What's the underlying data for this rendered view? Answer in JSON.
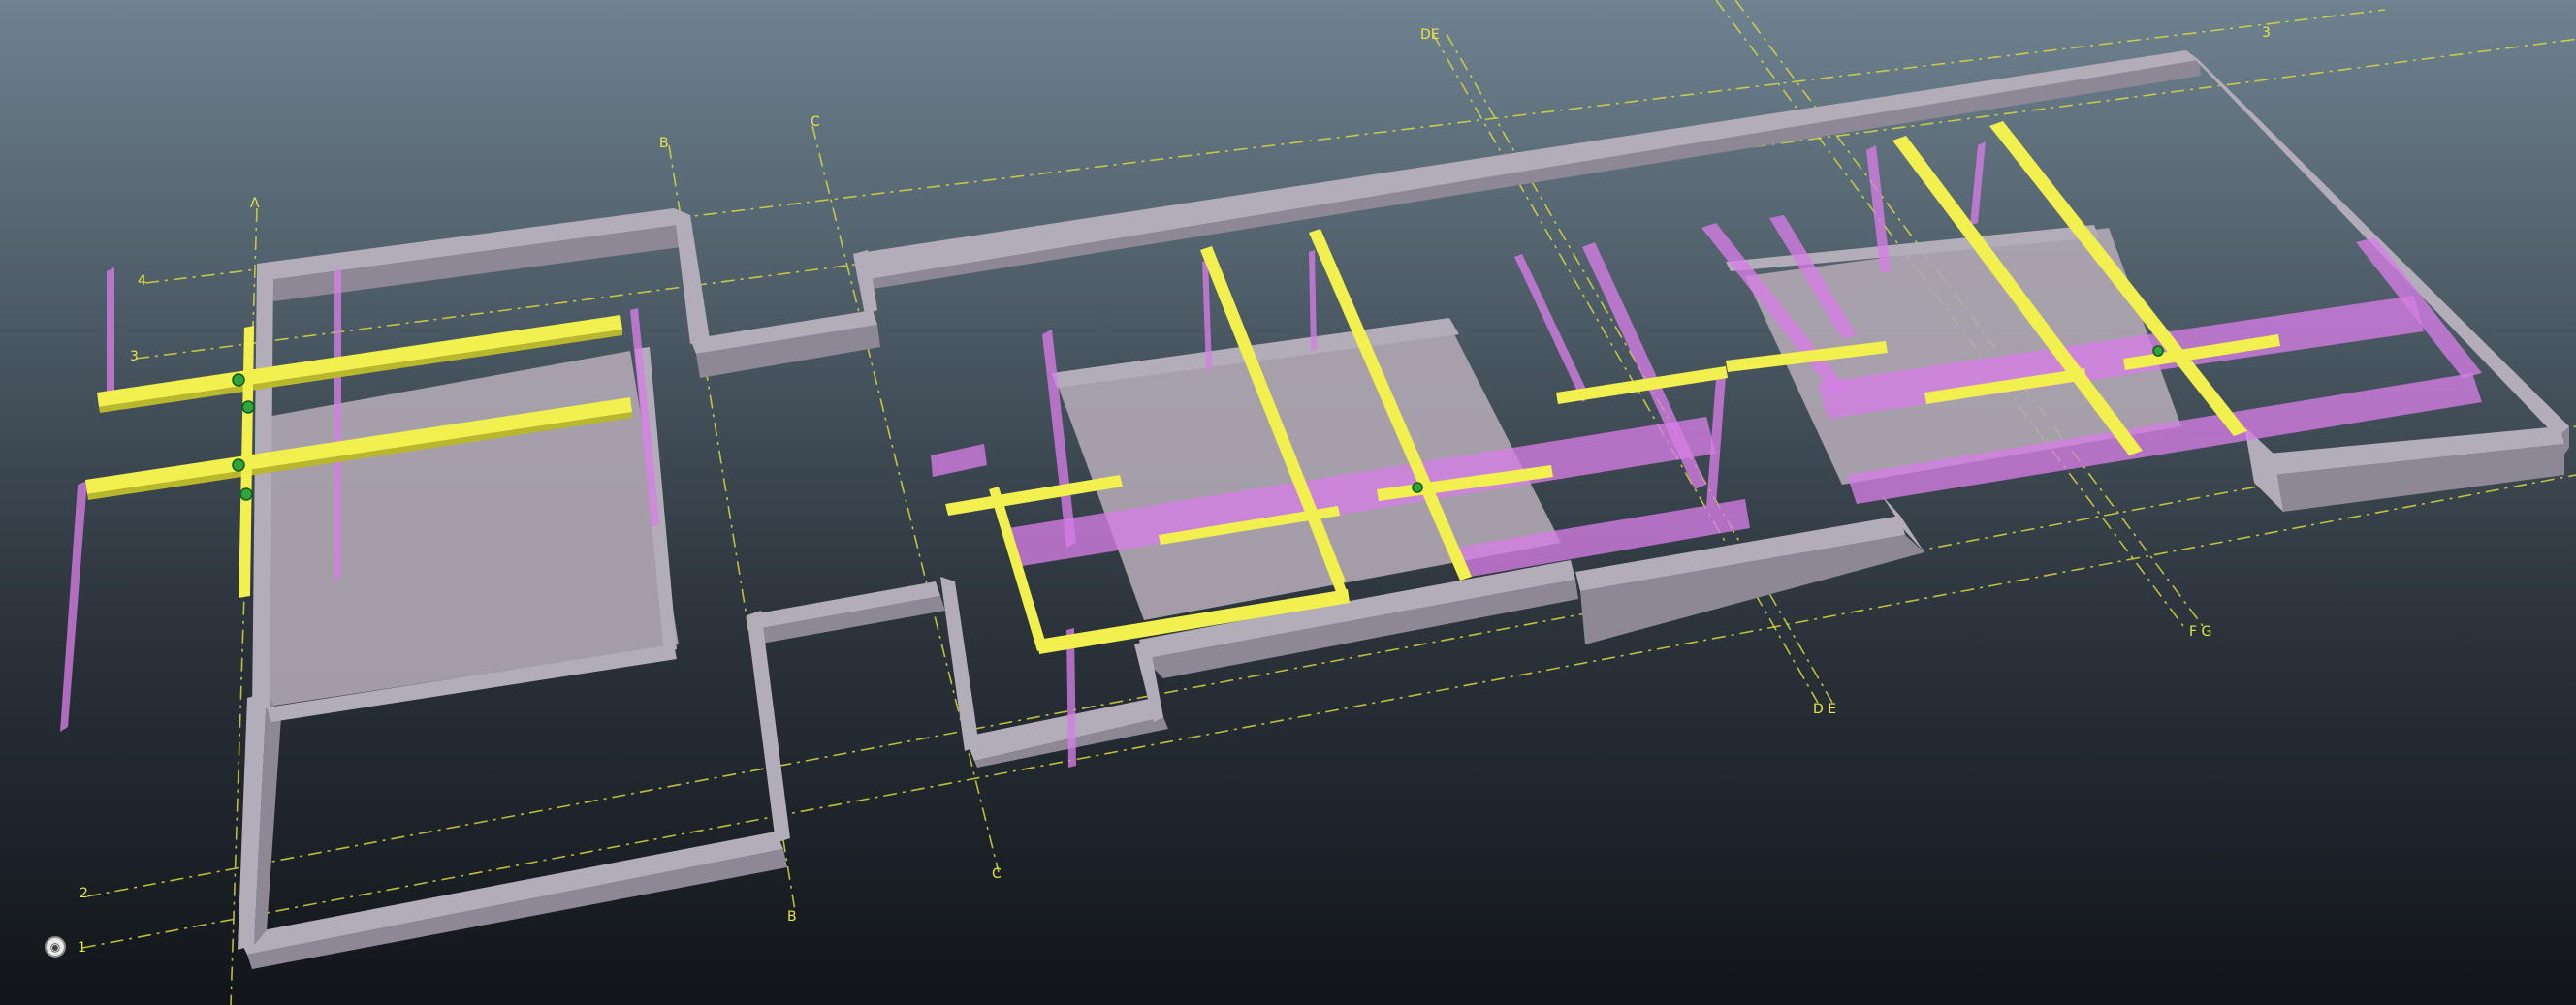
{
  "grid_labels": {
    "A": "A",
    "B": "B",
    "B_bottom": "B",
    "C": "C",
    "C_bottom": "C",
    "DE_top": "DE",
    "DE_bottom": "D E",
    "FG_bottom": "F G",
    "row_1": "1",
    "row_2": "2",
    "row_3_left": "3",
    "row_3_right": "3",
    "row_4": "4"
  },
  "colors": {
    "wall": "#b3adb9",
    "duct": "#d67ee6",
    "beam": "#f1f04f",
    "grid": "#d8d840",
    "node": "#2fa43a"
  },
  "nav_button": {
    "icon": "camera-icon",
    "glyph": "◉"
  }
}
